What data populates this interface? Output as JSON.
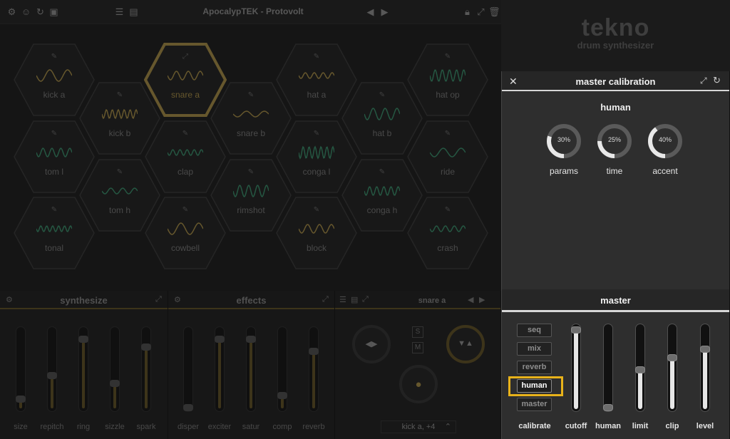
{
  "topbar": {
    "preset_name": "ApocalypTEK - Protovolt",
    "icons": [
      "gear-icon",
      "smiley-icon",
      "reset-icon",
      "save-disk-icon",
      "list-icon",
      "save-icon",
      "prev-arrow-icon",
      "next-arrow-icon",
      "lock-icon",
      "expand-icon",
      "trash-icon"
    ]
  },
  "pads": [
    {
      "label": "kick a"
    },
    {
      "label": "snare a"
    },
    {
      "label": "hat a"
    },
    {
      "label": "hat op"
    },
    {
      "label": "kick b"
    },
    {
      "label": "snare b"
    },
    {
      "label": "hat b"
    },
    {
      "label": "tom l"
    },
    {
      "label": "clap"
    },
    {
      "label": "conga l"
    },
    {
      "label": "ride"
    },
    {
      "label": "tom h"
    },
    {
      "label": "rimshot"
    },
    {
      "label": "conga h"
    },
    {
      "label": "tonal"
    },
    {
      "label": "cowbell"
    },
    {
      "label": "block"
    },
    {
      "label": "crash"
    }
  ],
  "synthesize": {
    "title": "synthesize",
    "sliders": [
      {
        "label": "size",
        "value": 0.15
      },
      {
        "label": "repitch",
        "value": 0.45
      },
      {
        "label": "ring",
        "value": 0.9
      },
      {
        "label": "sizzle",
        "value": 0.35
      },
      {
        "label": "spark",
        "value": 0.8
      }
    ]
  },
  "effects": {
    "title": "effects",
    "sliders": [
      {
        "label": "disper",
        "value": 0.0
      },
      {
        "label": "exciter",
        "value": 0.9
      },
      {
        "label": "satur",
        "value": 0.9
      },
      {
        "label": "comp",
        "value": 0.2
      },
      {
        "label": "reverb",
        "value": 0.75
      }
    ]
  },
  "sequencer": {
    "title": "snare a",
    "solo_label": "S",
    "mute_label": "M",
    "pattern_label": "kick a, +4"
  },
  "logo": {
    "title": "tekno",
    "subtitle": "drum synthesizer"
  },
  "calibration": {
    "title": "master calibration",
    "section_title": "human",
    "knobs": [
      {
        "label": "params",
        "value_text": "30%",
        "value": 0.3
      },
      {
        "label": "time",
        "value_text": "25%",
        "value": 0.25
      },
      {
        "label": "accent",
        "value_text": "40%",
        "value": 0.4
      }
    ]
  },
  "master": {
    "title": "master",
    "buttons": [
      {
        "label": "seq",
        "active": false
      },
      {
        "label": "mix",
        "active": false
      },
      {
        "label": "reverb",
        "active": false
      },
      {
        "label": "human",
        "active": true
      },
      {
        "label": "master",
        "active": false
      }
    ],
    "calibrate_label": "calibrate",
    "sliders": [
      {
        "label": "cutoff",
        "value": 0.98
      },
      {
        "label": "human",
        "value": 0.0
      },
      {
        "label": "limit",
        "value": 0.5
      },
      {
        "label": "clip",
        "value": 0.65
      },
      {
        "label": "level",
        "value": 0.75
      }
    ]
  },
  "colors": {
    "accent_gold": "#c8a84a",
    "panel_bg": "#2e2e2e",
    "highlight": "#e8b21a"
  }
}
